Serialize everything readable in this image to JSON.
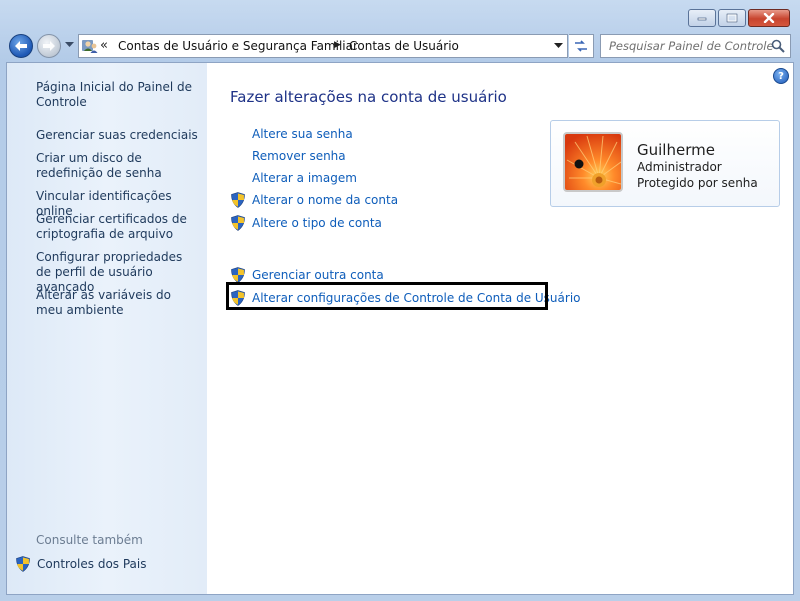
{
  "address": {
    "crumbs": [
      "Contas de Usuário e Segurança Familiar",
      "Contas de Usuário"
    ]
  },
  "search": {
    "placeholder": "Pesquisar Painel de Controle"
  },
  "sidebar": {
    "links": [
      "Página Inicial do Painel de Controle",
      "Gerenciar suas credenciais",
      "Criar um disco de redefinição de senha",
      "Vincular identificações online",
      "Gerenciar certificados de criptografia de arquivo",
      "Configurar propriedades de perfil de usuário avançado",
      "Alterar as variáveis do meu ambiente"
    ],
    "see_also_label": "Consulte também",
    "see_also_links": [
      "Controles dos Pais"
    ]
  },
  "main": {
    "title": "Fazer alterações na conta de usuário",
    "tasks": [
      "Altere sua senha",
      "Remover senha",
      "Alterar a imagem",
      "Alterar o nome da conta",
      "Altere o tipo de conta"
    ],
    "other_tasks": [
      "Gerenciar outra conta",
      "Alterar configurações de Controle de Conta de Usuário"
    ]
  },
  "user": {
    "name": "Guilherme",
    "role": "Administrador",
    "status": "Protegido por senha"
  },
  "icons": {
    "shield": "uac-shield-icon",
    "help": "help-icon",
    "search": "search-icon"
  },
  "colors": {
    "link": "#0e5dba",
    "title": "#1e3287",
    "sidebar_link": "#1e395b"
  }
}
